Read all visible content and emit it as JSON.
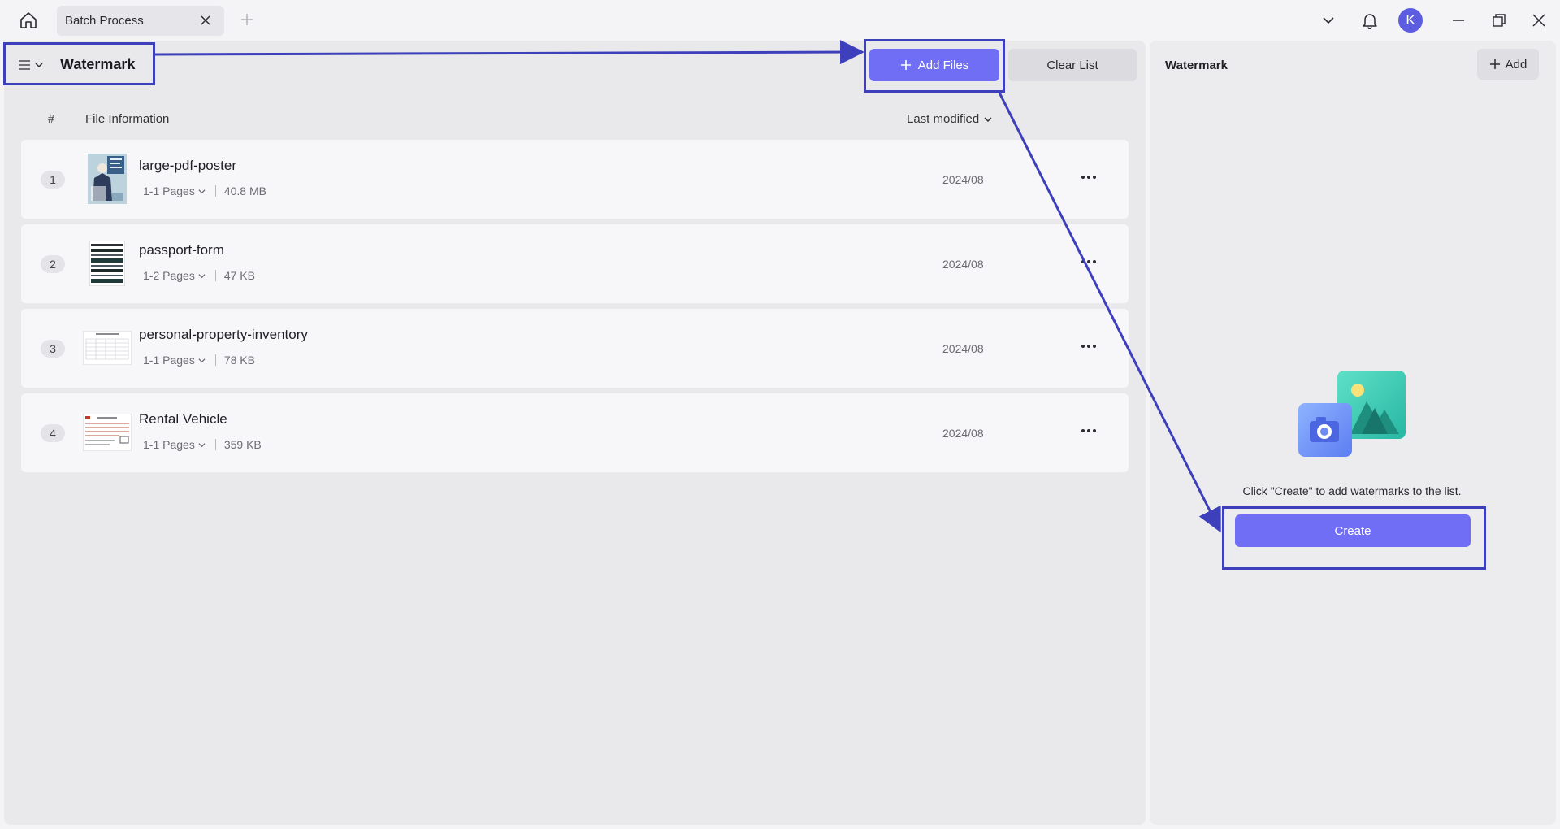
{
  "titlebar": {
    "tab_title": "Batch Process",
    "avatar_letter": "K",
    "icons": [
      "home-icon",
      "close-icon",
      "plus-icon",
      "chevron-down-icon",
      "bell-icon",
      "minimize-icon",
      "restore-icon",
      "close-icon"
    ]
  },
  "toolbar": {
    "mode_title": "Watermark",
    "add_files_label": "Add Files",
    "clear_list_label": "Clear List"
  },
  "table": {
    "col_number": "#",
    "col_info": "File Information",
    "sort_label": "Last modified"
  },
  "files": [
    {
      "index": "1",
      "name": "large-pdf-poster",
      "pages": "1-1 Pages",
      "size": "40.8 MB",
      "date": "2024/08"
    },
    {
      "index": "2",
      "name": "passport-form",
      "pages": "1-2 Pages",
      "size": "47 KB",
      "date": "2024/08"
    },
    {
      "index": "3",
      "name": "personal-property-inventory",
      "pages": "1-1 Pages",
      "size": "78 KB",
      "date": "2024/08"
    },
    {
      "index": "4",
      "name": "Rental Vehicle",
      "pages": "1-1 Pages",
      "size": "359 KB",
      "date": "2024/08"
    }
  ],
  "right_panel": {
    "title": "Watermark",
    "add_label": "Add",
    "hint": "Click \"Create\" to add watermarks to the list.",
    "create_label": "Create"
  },
  "colors": {
    "accent": "#6f6ef5",
    "annotation": "#3d3fbb",
    "avatar": "#5b5ce0"
  }
}
